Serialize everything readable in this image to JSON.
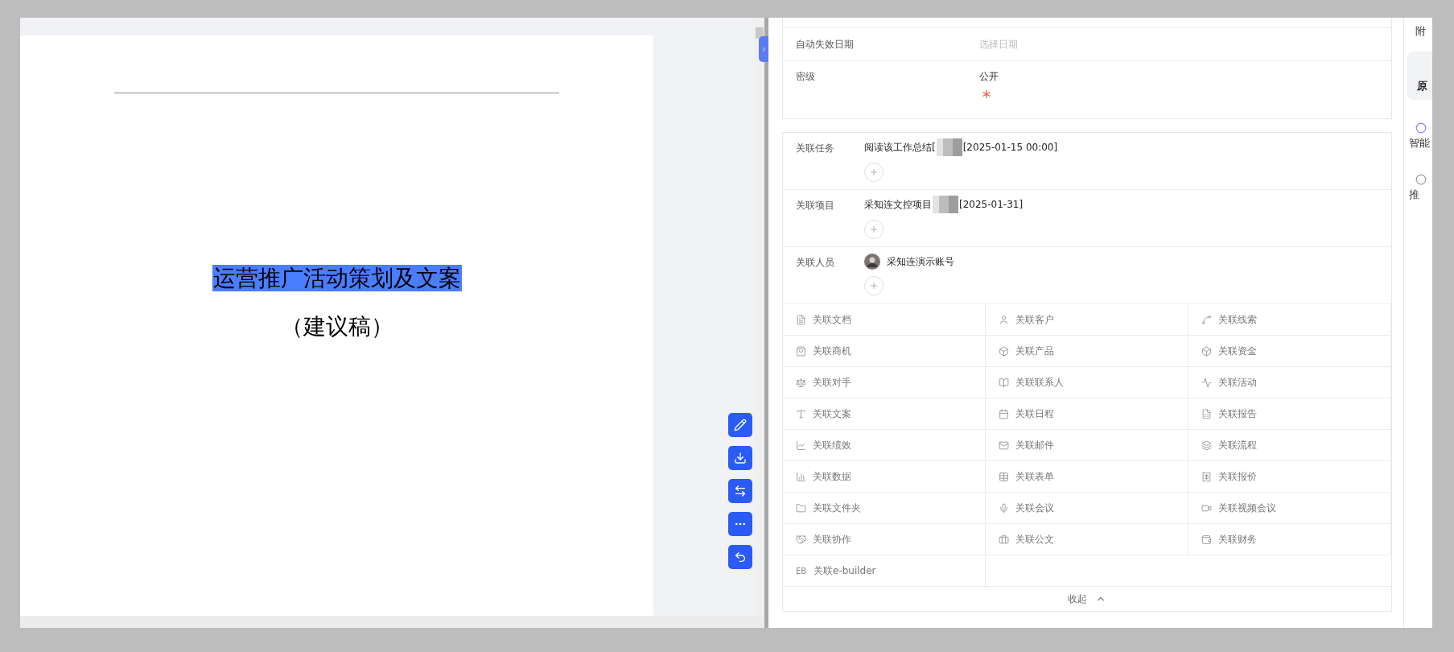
{
  "document": {
    "title": "运营推广活动策划及文案",
    "title_selected": true,
    "subtitle": "（建议稿）"
  },
  "form_fields": [
    {
      "label": "自动失效日期",
      "placeholder": "选择日期",
      "kind": "date"
    },
    {
      "label": "密级",
      "value": "公开",
      "required": true,
      "kind": "text"
    }
  ],
  "relations": [
    {
      "label": "关联任务",
      "items": [
        {
          "kind": "record",
          "text": "阅读该工作总结[",
          "redacted": true,
          "suffix": "[2025-01-15 00:00]"
        }
      ]
    },
    {
      "label": "关联项目",
      "items": [
        {
          "kind": "record",
          "text": "采知连文控项目",
          "redacted": true,
          "suffix": "[2025-01-31]"
        }
      ]
    },
    {
      "label": "关联人员",
      "items": [
        {
          "kind": "person",
          "text": "采知连演示账号"
        }
      ]
    }
  ],
  "link_types": [
    {
      "label": "关联文档",
      "kind": "doc"
    },
    {
      "label": "关联客户",
      "kind": "user"
    },
    {
      "label": "关联线索",
      "kind": "clue"
    },
    {
      "label": "关联商机",
      "kind": "bag"
    },
    {
      "label": "关联产品",
      "kind": "box"
    },
    {
      "label": "关联资金",
      "kind": "box"
    },
    {
      "label": "关联对手",
      "kind": "scale"
    },
    {
      "label": "关联联系人",
      "kind": "book"
    },
    {
      "label": "关联活动",
      "kind": "activity"
    },
    {
      "label": "关联文案",
      "kind": "type"
    },
    {
      "label": "关联日程",
      "kind": "calendar"
    },
    {
      "label": "关联报告",
      "kind": "report"
    },
    {
      "label": "关联绩效",
      "kind": "chart"
    },
    {
      "label": "关联邮件",
      "kind": "mail"
    },
    {
      "label": "关联流程",
      "kind": "layers"
    },
    {
      "label": "关联数据",
      "kind": "bars"
    },
    {
      "label": "关联表单",
      "kind": "table"
    },
    {
      "label": "关联报价",
      "kind": "receipt"
    },
    {
      "label": "关联文件夹",
      "kind": "folder"
    },
    {
      "label": "关联会议",
      "kind": "meeting"
    },
    {
      "label": "关联视频会议",
      "kind": "video"
    },
    {
      "label": "关联协作",
      "kind": "handshake"
    },
    {
      "label": "关联公文",
      "kind": "briefcase"
    },
    {
      "label": "关联财务",
      "kind": "wallet"
    },
    {
      "label": "关联e-builder",
      "kind": "text",
      "icon_text": "EB"
    }
  ],
  "collapse_label": "收起",
  "side_strip": [
    {
      "label": "附",
      "kind": "text"
    },
    {
      "label": "原",
      "kind": "tab",
      "selected": true
    },
    {
      "label": "智能",
      "kind": "icon"
    },
    {
      "label": "推",
      "kind": "icon"
    }
  ]
}
